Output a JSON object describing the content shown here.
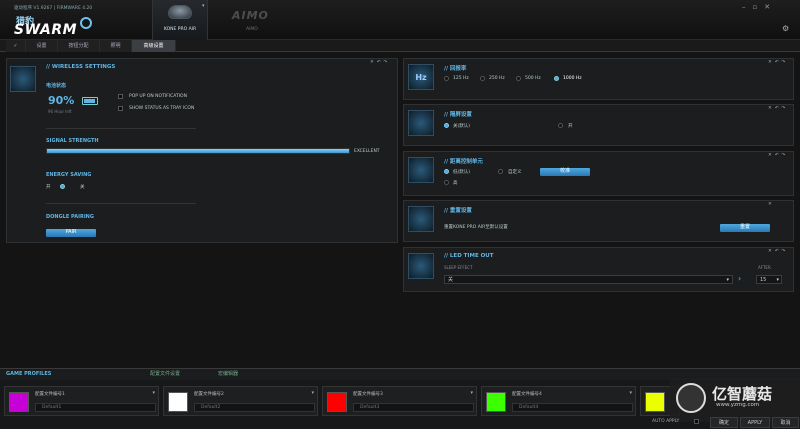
{
  "app": {
    "version": "驱动程序 V1.9267 | FIRMWARE 4.20",
    "brand_cn": "猎豹",
    "brand": "SWARM",
    "device_tab": "KONE PRO AIR",
    "device2_logo": "AIMO",
    "device2_name": "AIMO",
    "window_buttons": "–▫✕"
  },
  "tabs": [
    {
      "label": "✓",
      "active": false
    },
    {
      "label": "设置",
      "active": false
    },
    {
      "label": "按钮分配",
      "active": false
    },
    {
      "label": "照明",
      "active": false
    },
    {
      "label": "高级设置",
      "active": true
    }
  ],
  "wireless": {
    "title": "// WIRELESS SETTINGS",
    "battery_label": "电池状态",
    "battery_pct": "90%",
    "battery_level": 0.9,
    "hours_left": "96 Hour left",
    "popup_label": "POP UP ON NOTIFICATION",
    "tray_label": "SHOW STATUS AS TRAY ICON",
    "signal_title": "SIGNAL STRENGTH",
    "signal_value": "EXCELLENT",
    "signal_level": 1.0,
    "energy_title": "ENERGY SAVING",
    "energy_options": [
      "开",
      "关"
    ],
    "dongle_title": "DONGLE PAIRING",
    "pair_button": "PAIR"
  },
  "polling": {
    "title": "// 回报率",
    "options": [
      "125 Hz",
      "250 Hz",
      "500 Hz",
      "1000 Hz"
    ],
    "selected": "1000 Hz"
  },
  "sensor": {
    "title": "// 隔屏设置",
    "options": [
      "关(默认)",
      "开"
    ]
  },
  "pointer": {
    "title": "// 距离控制单元",
    "options": [
      "低(默认)",
      "自定义",
      "高"
    ],
    "button": "校准"
  },
  "reset": {
    "title": "// 重置设置",
    "text": "重置KONE PRO AIR至默认设置",
    "button": "重置"
  },
  "led": {
    "title": "// LED TIME OUT",
    "sleep_label": "SLEEP EFFECT",
    "sleep_value": "关",
    "after_label": "AFTER",
    "after_value": "15"
  },
  "profiles_bar": {
    "title": "GAME PROFILES",
    "tab2": "配置文件设置",
    "tab3": "宏编辑器"
  },
  "profiles": [
    {
      "name": "配置文件编号1",
      "default": "Default1",
      "color": "#c800d8"
    },
    {
      "name": "配置文件编号2",
      "default": "Default2",
      "color": "#ffffff"
    },
    {
      "name": "配置文件编号3",
      "default": "Default3",
      "color": "#ff0000"
    },
    {
      "name": "配置文件编号4",
      "default": "Default4",
      "color": "#3cff00"
    },
    {
      "name": "",
      "default": "",
      "color": "#eaff00"
    }
  ],
  "bottom": {
    "auto_apply": "AUTO APPLY",
    "confirm": "确定",
    "apply": "APPLY",
    "cancel": "取消"
  },
  "watermark": {
    "cn": "亿智蘑菇",
    "url": "www.yzmg.com"
  }
}
